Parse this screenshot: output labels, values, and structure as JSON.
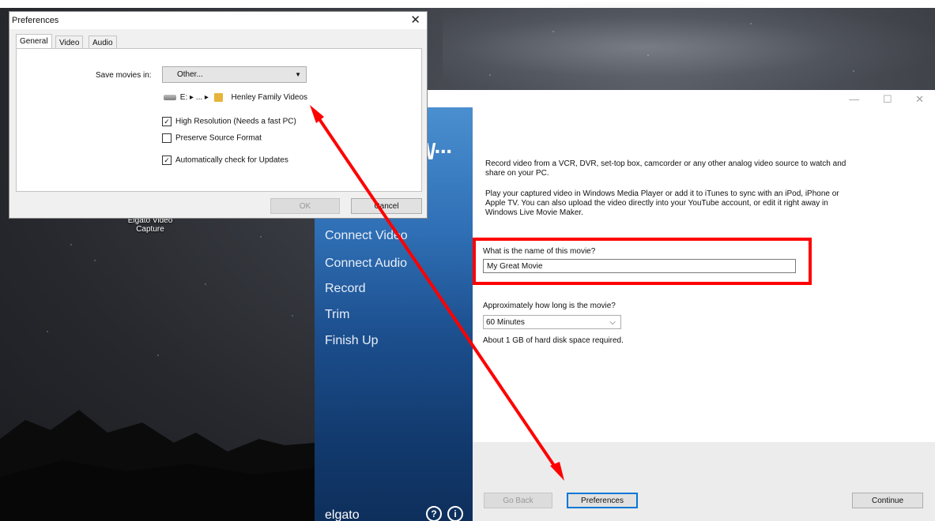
{
  "desktop": {
    "icon_label_line1": "Elgato Video",
    "icon_label_line2": "Capture"
  },
  "elgato": {
    "nav_items": [
      "Connect Video",
      "Connect Audio",
      "Record",
      "Trim",
      "Finish Up"
    ],
    "brand": "elgato",
    "help_glyph": "?",
    "info_glyph": "i",
    "window_controls": [
      "—",
      "☐",
      "✕"
    ],
    "intro_text_1": "Record video from a VCR, DVR, set-top box, camcorder or any other analog video source to watch and share on your PC.",
    "intro_text_2": "Play your captured video in Windows Media Player or add it to iTunes to sync with an iPod, iPhone or Apple TV. You can also upload the video directly into your YouTube account, or edit it right away in Windows Live Movie Maker.",
    "name_label": "What is the name of this movie?",
    "name_value": "My Great Movie",
    "duration_label": "Approximately how long is the movie?",
    "duration_value": "60 Minutes",
    "disk_note": "About 1 GB of hard disk space required.",
    "back_button": "Go Back",
    "preferences_button": "Preferences",
    "continue_button": "Continue"
  },
  "preferences": {
    "title": "Preferences",
    "close_glyph": "✕",
    "tabs": [
      "General",
      "Video",
      "Audio"
    ],
    "save_label": "Save movies in:",
    "save_value": "Other...",
    "path_prefix": "E: ▸ ... ▸",
    "folder_name": "Henley Family Videos",
    "options": [
      {
        "label": "High Resolution (Needs a fast PC)",
        "checked": true
      },
      {
        "label": "Preserve Source Format",
        "checked": false
      },
      {
        "label": "Automatically check for Updates",
        "checked": true
      }
    ],
    "ok_button": "OK",
    "cancel_button": "Cancel"
  },
  "colors": {
    "annotation_red": "#ff0000",
    "accent_blue": "#0078d7",
    "sidebar_blue": "#1c4f8e"
  }
}
